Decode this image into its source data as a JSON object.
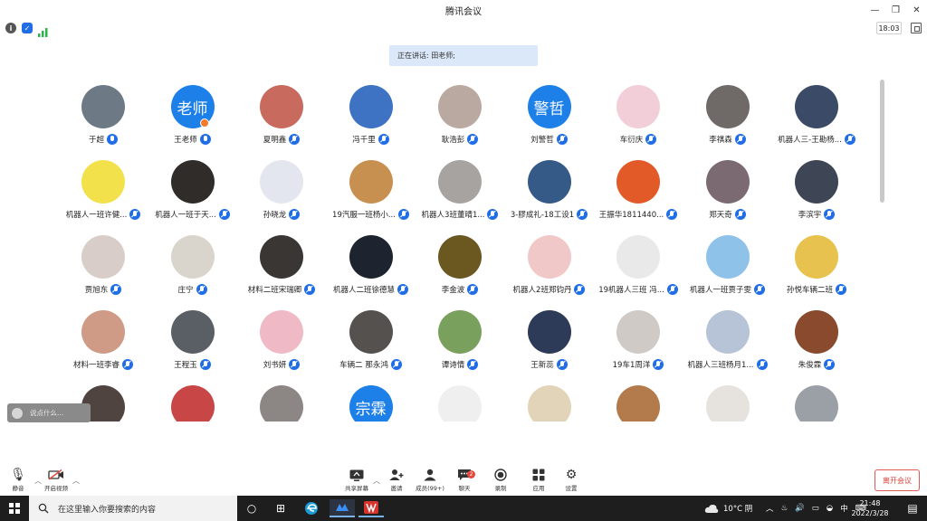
{
  "window": {
    "title": "腾讯会议",
    "clock": "18:03"
  },
  "icons": {
    "minimize": "minimize-icon",
    "restore": "restore-icon",
    "close": "close-icon",
    "info": "info-icon",
    "shield": "shield-icon",
    "signal": "signal-icon",
    "fullscreen": "fullscreen-icon"
  },
  "banner": {
    "speaking": "正在讲话: 田老师;"
  },
  "participants": [
    {
      "name": "于超",
      "muted": false,
      "avatar": "#6d7a86"
    },
    {
      "name": "王老师",
      "muted": false,
      "avatar": "#1d7fe8",
      "text": "老师",
      "dot": true
    },
    {
      "name": "夏明鑫",
      "muted": true,
      "avatar": "#c96a5e"
    },
    {
      "name": "冯千里",
      "muted": true,
      "avatar": "#3e73c4"
    },
    {
      "name": "耿浩彭",
      "muted": true,
      "avatar": "#b9a9a0"
    },
    {
      "name": "刘警哲",
      "muted": true,
      "avatar": "#1d7fe8",
      "text": "警哲"
    },
    {
      "name": "车衍庆",
      "muted": true,
      "avatar": "#f2cfd8"
    },
    {
      "name": "李祺森",
      "muted": true,
      "avatar": "#6f6a68"
    },
    {
      "name": "机器人三-王勘杨...",
      "muted": true,
      "avatar": "#3b4a66"
    },
    {
      "name": "机器人一班许健...",
      "muted": true,
      "avatar": "#f2e14a"
    },
    {
      "name": "机器人一班于天...",
      "muted": true,
      "avatar": "#2f2c2a"
    },
    {
      "name": "孙晓龙",
      "muted": true,
      "avatar": "#e3e6ee"
    },
    {
      "name": "19汽服一班杨小...",
      "muted": true,
      "avatar": "#c89050"
    },
    {
      "name": "机器人3班董晴1...",
      "muted": true,
      "avatar": "#a7a3a1"
    },
    {
      "name": "3-膠成礼-18工设1",
      "muted": true,
      "avatar": "#355a88"
    },
    {
      "name": "王振华1811440...",
      "muted": true,
      "avatar": "#e25a28"
    },
    {
      "name": "郑天奇",
      "muted": true,
      "avatar": "#7c6a72"
    },
    {
      "name": "李滨宇",
      "muted": true,
      "avatar": "#3e4555"
    },
    {
      "name": "贾旭东",
      "muted": true,
      "avatar": "#d8cdc8"
    },
    {
      "name": "庄宁",
      "muted": true,
      "avatar": "#d9d4cc"
    },
    {
      "name": "材料二班宋瑞卿",
      "muted": true,
      "avatar": "#3a3634"
    },
    {
      "name": "机器人二班徐德慧",
      "muted": true,
      "avatar": "#1e2330"
    },
    {
      "name": "李金波",
      "muted": true,
      "avatar": "#6b5720"
    },
    {
      "name": "机器人2班郑钧丹",
      "muted": true,
      "avatar": "#f1c8c8"
    },
    {
      "name": "19机器人三班 冯...",
      "muted": true,
      "avatar": "#e9e9ea"
    },
    {
      "name": "机器人一班贾子雯",
      "muted": true,
      "avatar": "#8fc2e8"
    },
    {
      "name": "孙悦车辆二班",
      "muted": true,
      "avatar": "#e8c24e"
    },
    {
      "name": "材料一班李睿",
      "muted": true,
      "avatar": "#cf9b86"
    },
    {
      "name": "王程玉",
      "muted": true,
      "avatar": "#5a5f66"
    },
    {
      "name": "刘书妍",
      "muted": true,
      "avatar": "#efb9c6"
    },
    {
      "name": "车辆二 那永鸿",
      "muted": true,
      "avatar": "#55514e"
    },
    {
      "name": "谭诗情",
      "muted": true,
      "avatar": "#7aa05d"
    },
    {
      "name": "王新蕊",
      "muted": true,
      "avatar": "#2d3b58"
    },
    {
      "name": "19车1周洋",
      "muted": true,
      "avatar": "#cfcac6"
    },
    {
      "name": "机器人三班杨月1...",
      "muted": true,
      "avatar": "#b7c3d6"
    },
    {
      "name": "朱俊霖",
      "muted": true,
      "avatar": "#8a4a2e"
    },
    {
      "name": "",
      "muted": true,
      "avatar": "#4f4440"
    },
    {
      "name": "",
      "muted": true,
      "avatar": "#c94646"
    },
    {
      "name": "",
      "muted": true,
      "avatar": "#8c8784"
    },
    {
      "name": "",
      "muted": true,
      "avatar": "#1d7fe8",
      "text": "宗霖"
    },
    {
      "name": "",
      "muted": true,
      "avatar": "#efefef"
    },
    {
      "name": "",
      "muted": true,
      "avatar": "#e2d4b8"
    },
    {
      "name": "",
      "muted": true,
      "avatar": "#b37a4b"
    },
    {
      "name": "",
      "muted": true,
      "avatar": "#e6e2de"
    },
    {
      "name": "",
      "muted": true,
      "avatar": "#9aa0a6"
    }
  ],
  "chat_input": {
    "placeholder": "说点什么..."
  },
  "toolbar": {
    "mute": "静音",
    "video": "开启视频",
    "share": "共享屏幕",
    "invite": "邀请",
    "members": "成员(99+)",
    "chat": "聊天",
    "chat_badge": "2",
    "record": "录制",
    "apps": "应用",
    "settings": "设置",
    "leave": "离开会议"
  },
  "taskbar": {
    "search_placeholder": "在这里输入你要搜索的内容",
    "weather": "10°C 阴",
    "ime": "中",
    "time": "21:48",
    "date": "2022/3/28"
  }
}
